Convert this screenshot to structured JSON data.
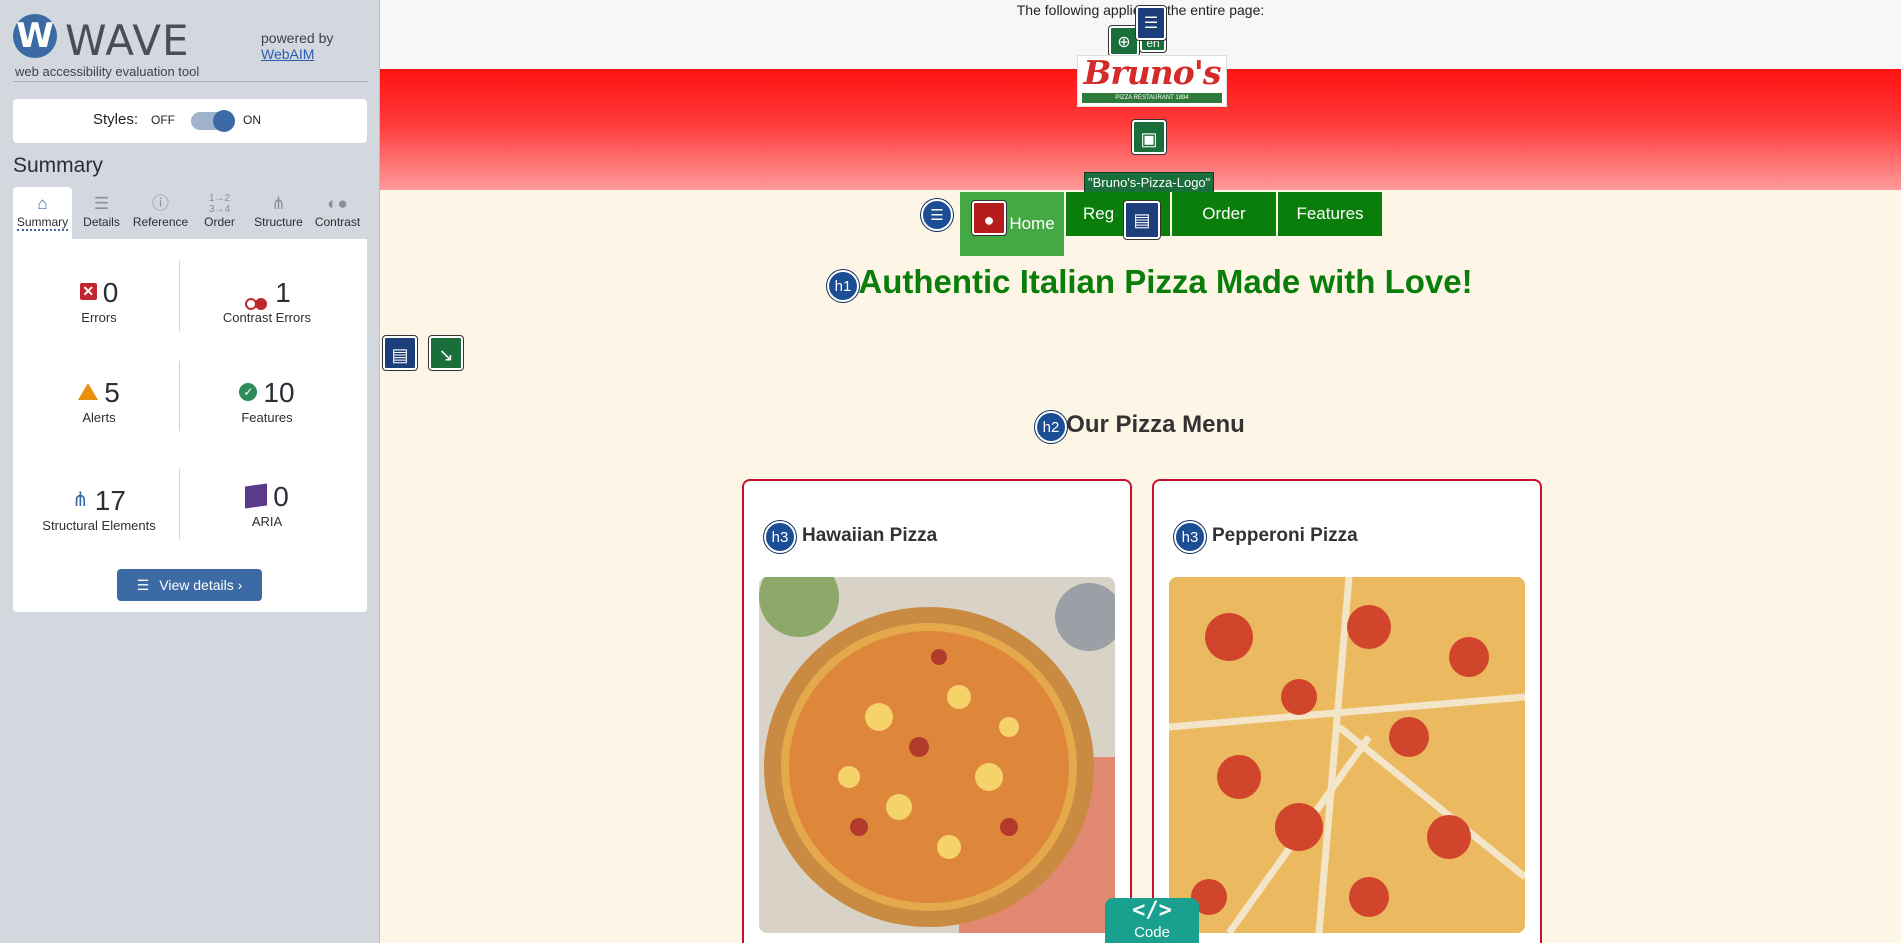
{
  "wave": {
    "title": "WAVE",
    "subtitle": "web accessibility evaluation tool",
    "powered_by": "powered by",
    "powered_link": "WebAIM",
    "styles_label": "Styles:",
    "styles_off": "OFF",
    "styles_on": "ON",
    "summary_title": "Summary",
    "tabs": [
      {
        "label": "Summary",
        "icon": "home-icon",
        "active": true
      },
      {
        "label": "Details",
        "icon": "list-icon"
      },
      {
        "label": "Reference",
        "icon": "info-icon"
      },
      {
        "label": "Order",
        "icon": "order-icon"
      },
      {
        "label": "Structure",
        "icon": "structure-icon"
      },
      {
        "label": "Contrast",
        "icon": "contrast-icon"
      }
    ],
    "stats": {
      "errors": {
        "value": "0",
        "label": "Errors"
      },
      "contrast_errors": {
        "value": "1",
        "label": "Contrast Errors"
      },
      "alerts": {
        "value": "5",
        "label": "Alerts"
      },
      "features": {
        "value": "10",
        "label": "Features"
      },
      "structural": {
        "value": "17",
        "label": "Structural Elements"
      },
      "aria": {
        "value": "0",
        "label": "ARIA"
      }
    },
    "view_details": "View details ›"
  },
  "page": {
    "notice": "The following applies to the entire page:",
    "logo_text": "Bruno's",
    "logo_ribbon": "PIZZA RESTAURANT 1894",
    "logo_alt": "\"Bruno's-Pizza-Logo\"",
    "lang_badge": "en",
    "nav": [
      "Home",
      "Register",
      "Order",
      "Features"
    ],
    "h1": "Authentic Italian Pizza Made with Love!",
    "h2": "Our Pizza Menu",
    "cards": [
      {
        "title": "Hawaiian Pizza"
      },
      {
        "title": "Pepperoni Pizza"
      }
    ],
    "heading_badges": {
      "h1": "h1",
      "h2": "h2",
      "h3": "h3"
    },
    "code_tab": "Code"
  },
  "colors": {
    "wave_blue": "#3c6aa5",
    "error_red": "#c0262d",
    "alert_orange": "#e6900c",
    "feature_green": "#2f8a5c",
    "nav_green": "#0a7e0a",
    "card_border": "#c8102e",
    "page_bg": "#fdf5e6"
  }
}
